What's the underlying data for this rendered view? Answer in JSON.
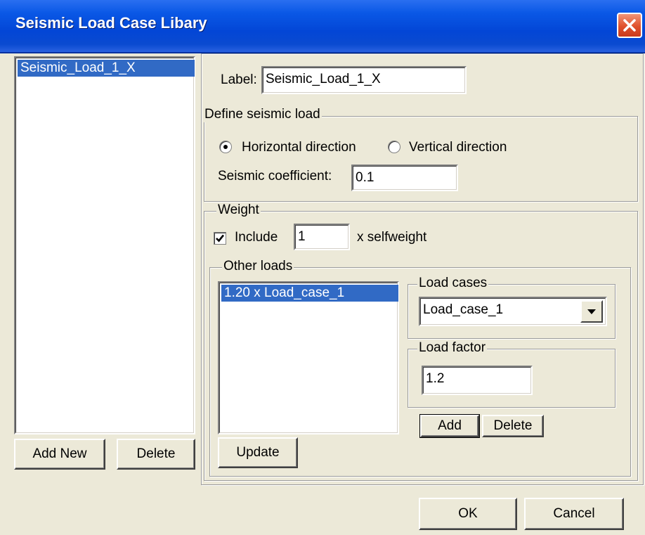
{
  "window": {
    "title": "Seismic Load Case Libary"
  },
  "left_panel": {
    "load_cases": [
      "Seismic_Load_1_X"
    ],
    "add_new_label": "Add New",
    "delete_label": "Delete"
  },
  "label_field": {
    "label": "Label:",
    "value": "Seismic_Load_1_X"
  },
  "define_seismic": {
    "legend": "Define seismic load",
    "direction_options": [
      {
        "label": "Horizontal direction",
        "selected": true
      },
      {
        "label": "Vertical direction",
        "selected": false
      }
    ],
    "coefficient_label": "Seismic coefficient:",
    "coefficient_value": "0.1"
  },
  "weight": {
    "legend": "Weight",
    "include_label": "Include",
    "include_checked": true,
    "selfweight_factor": "1",
    "selfweight_suffix": "x selfweight",
    "other_loads": {
      "legend": "Other loads",
      "items": [
        "1.20 x Load_case_1"
      ],
      "update_label": "Update",
      "load_cases": {
        "legend": "Load cases",
        "selected": "Load_case_1"
      },
      "load_factor": {
        "legend": "Load factor",
        "value": "1.2"
      },
      "add_label": "Add",
      "delete_label": "Delete"
    }
  },
  "footer": {
    "ok_label": "OK",
    "cancel_label": "Cancel"
  }
}
